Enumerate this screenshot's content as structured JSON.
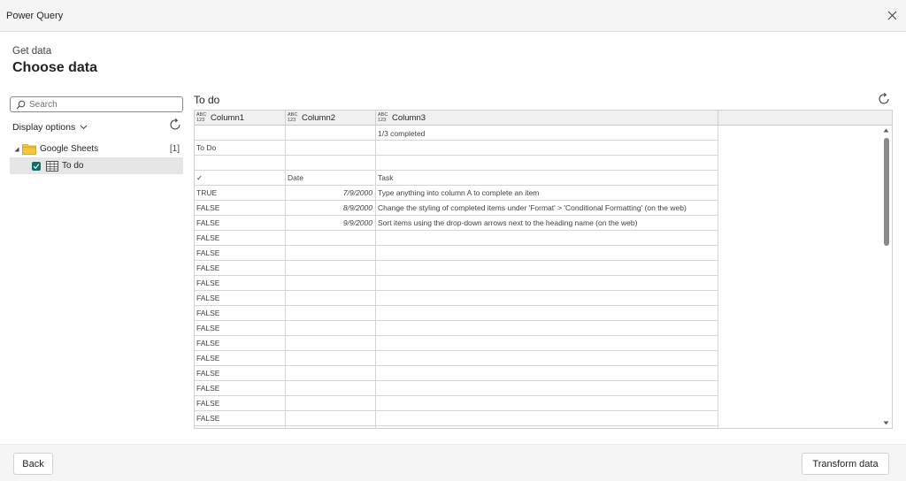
{
  "window": {
    "title": "Power Query"
  },
  "header": {
    "subtitle": "Get data",
    "title": "Choose data"
  },
  "navigator": {
    "search_placeholder": "Search",
    "display_options_label": "Display options",
    "tree": [
      {
        "label": "Google Sheets",
        "count": "[1]",
        "expanded": true
      },
      {
        "label": "To do",
        "checked": true,
        "selected": true
      }
    ]
  },
  "preview": {
    "title": "To do",
    "columns": [
      {
        "type": "ABC\n123",
        "name": "Column1"
      },
      {
        "type": "ABC\n123",
        "name": "Column2"
      },
      {
        "type": "ABC\n123",
        "name": "Column3"
      }
    ],
    "rows": [
      [
        "",
        "",
        "1/3 completed"
      ],
      [
        "To Do",
        "",
        ""
      ],
      [
        "",
        "",
        ""
      ],
      [
        "✓",
        "Date",
        "Task"
      ],
      [
        "TRUE",
        "7/9/2000",
        "Type anything into column A to complete an item"
      ],
      [
        "FALSE",
        "8/9/2000",
        "Change the styling of completed items under 'Format' > 'Conditional Formatting' (on the web)"
      ],
      [
        "FALSE",
        "9/9/2000",
        "Sort items using the drop-down arrows next to the heading name (on the web)"
      ],
      [
        "FALSE",
        "",
        ""
      ],
      [
        "FALSE",
        "",
        ""
      ],
      [
        "FALSE",
        "",
        ""
      ],
      [
        "FALSE",
        "",
        ""
      ],
      [
        "FALSE",
        "",
        ""
      ],
      [
        "FALSE",
        "",
        ""
      ],
      [
        "FALSE",
        "",
        ""
      ],
      [
        "FALSE",
        "",
        ""
      ],
      [
        "FALSE",
        "",
        ""
      ],
      [
        "FALSE",
        "",
        ""
      ],
      [
        "FALSE",
        "",
        ""
      ],
      [
        "FALSE",
        "",
        ""
      ],
      [
        "FALSE",
        "",
        ""
      ],
      [
        "",
        "",
        ""
      ]
    ]
  },
  "footer": {
    "back_label": "Back",
    "transform_label": "Transform data"
  },
  "colors": {
    "accent": "#0f6f6a",
    "folder": "#f4c542"
  }
}
